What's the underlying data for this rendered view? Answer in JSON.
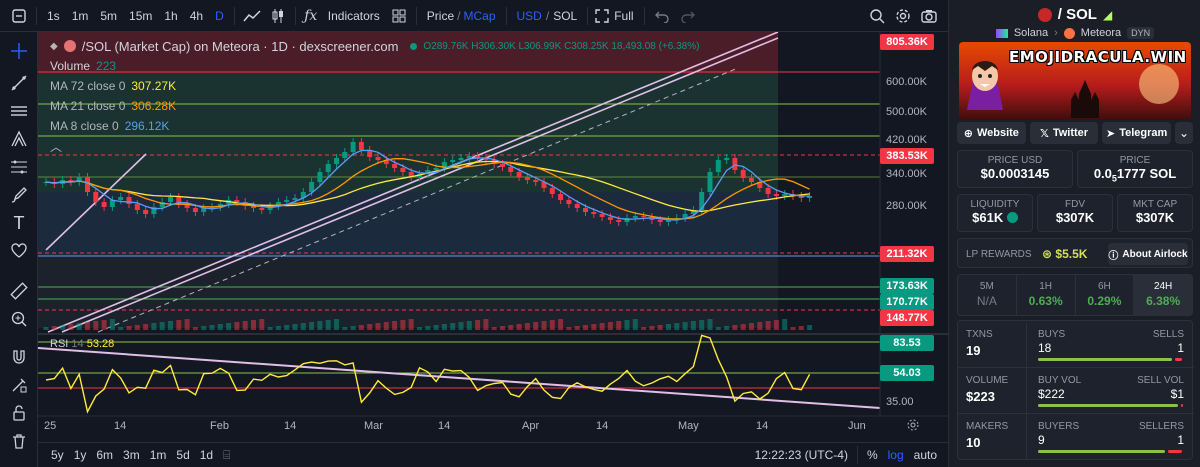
{
  "toolbar": {
    "intervals": [
      "1s",
      "1m",
      "5m",
      "15m",
      "1h",
      "4h",
      "D"
    ],
    "active_interval": "D",
    "indicators_label": "Indicators",
    "price_label": "Price",
    "mcap_label": "MCap",
    "usd_label": "USD",
    "sol_label": "SOL",
    "full_label": "Full"
  },
  "legend": {
    "title": "/SOL (Market Cap) on Meteora · 1D · dexscreener.com",
    "ohlc": "O289.76K H306.30K L306.99K C308.25K 18,493.08 (+6.38%)",
    "volume_label": "Volume",
    "volume_value": "223",
    "ma72_label": "MA 72 close 0",
    "ma72_value": "307.27K",
    "ma21_label": "MA 21 close 0",
    "ma21_value": "306.28K",
    "ma8_label": "MA 8 close 0",
    "ma8_value": "296.12K",
    "rsi_label": "RSI",
    "rsi_len": "14",
    "rsi_value": "53.28"
  },
  "price_axis": {
    "ticks": [
      "600.00K",
      "500.00K",
      "420.00K",
      "340.00K",
      "280.00K",
      "35.00"
    ],
    "tags": [
      {
        "text": "805.36K",
        "color": "#f23645"
      },
      {
        "text": "383.53K",
        "color": "#f23645"
      },
      {
        "text": "211.32K",
        "color": "#f23645"
      },
      {
        "text": "173.63K",
        "color": "#089981"
      },
      {
        "text": "170.77K",
        "color": "#089981"
      },
      {
        "text": "148.77K",
        "color": "#f23645"
      },
      {
        "text": "83.53",
        "color": "#089981"
      },
      {
        "text": "54.03",
        "color": "#089981"
      }
    ]
  },
  "time_axis": [
    "25",
    "14",
    "Feb",
    "14",
    "Mar",
    "14",
    "Apr",
    "14",
    "May",
    "14",
    "Jun"
  ],
  "bottom": {
    "ranges": [
      "5y",
      "1y",
      "6m",
      "3m",
      "1m",
      "5d",
      "1d"
    ],
    "clock": "12:22:23 (UTC-4)",
    "pct": "%",
    "log": "log",
    "auto": "auto"
  },
  "panel": {
    "pair": "/ SOL",
    "chain": "Solana",
    "dex": "Meteora",
    "dex_badge": "DYN",
    "banner_text": "EMOJIDRACULA.WIN",
    "website": "Website",
    "twitter": "Twitter",
    "telegram": "Telegram",
    "price_usd_label": "PRICE USD",
    "price_usd": "$0.0003145",
    "price_label": "PRICE",
    "price_sol_main": "0.0",
    "price_sol_sub": "5",
    "price_sol_tail": "1777 SOL",
    "liquidity_label": "LIQUIDITY",
    "liquidity": "$61K",
    "fdv_label": "FDV",
    "fdv": "$307K",
    "mktcap_label": "MKT CAP",
    "mktcap": "$307K",
    "lp_label": "LP REWARDS",
    "lp_value": "$5.5K",
    "about": "About Airlock",
    "tf": [
      {
        "label": "5M",
        "value": "N/A"
      },
      {
        "label": "1H",
        "value": "0.63%"
      },
      {
        "label": "6H",
        "value": "0.29%"
      },
      {
        "label": "24H",
        "value": "6.38%"
      }
    ],
    "txns_label": "TXNS",
    "txns": "19",
    "buys_label": "BUYS",
    "buys": "18",
    "sells_label": "SELLS",
    "sells": "1",
    "volume_label": "VOLUME",
    "volume": "$223",
    "buyvol_label": "BUY VOL",
    "buyvol": "$222",
    "sellvol_label": "SELL VOL",
    "sellvol": "$1",
    "makers_label": "MAKERS",
    "makers": "10",
    "buyers_label": "BUYERS",
    "buyers": "9",
    "sellers_label": "SELLERS",
    "sellers": "1",
    "buys_ratio": 0.947,
    "buyvol_ratio": 0.995,
    "buyers_ratio": 0.9
  },
  "colors": {
    "up": "#089981",
    "down": "#f23645",
    "ma72": "#ffeb3b",
    "ma21": "#ff9800",
    "ma8": "#5b9cf6",
    "rsi": "#ffeb3b",
    "accent": "#2962ff"
  }
}
